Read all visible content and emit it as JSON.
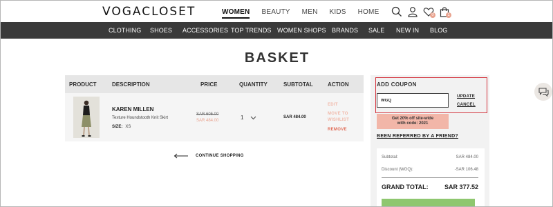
{
  "header": {
    "logo": "VOGACLOSET",
    "departments": [
      {
        "label": "WOMEN",
        "active": true
      },
      {
        "label": "BEAUTY",
        "active": false
      },
      {
        "label": "MEN",
        "active": false
      },
      {
        "label": "KIDS",
        "active": false
      },
      {
        "label": "HOME",
        "active": false
      }
    ],
    "icons": [
      "search-icon",
      "user-icon",
      "heart-icon",
      "bag-icon"
    ],
    "wishlist_count": "0",
    "bag_count": "1",
    "badge_color": "#e9a38f"
  },
  "category_nav": {
    "background": "#3a3a3a",
    "items": [
      "CLOTHING",
      "SHOES",
      "ACCESSORIES",
      "TOP TRENDS",
      "WOMEN SHOPS",
      "BRANDS",
      "SALE",
      "NEW IN",
      "BLOG"
    ]
  },
  "page": {
    "title": "BASKET"
  },
  "basket": {
    "columns": [
      "PRODUCT",
      "DESCRIPTION",
      "PRICE",
      "QUANTITY",
      "SUBTOTAL",
      "ACTION"
    ],
    "items": [
      {
        "brand": "KAREN MILLEN",
        "description": "Texture Houndstooth Knit Skirt",
        "size_label": "SIZE:",
        "size": "XS",
        "old_price": "SAR 605.00",
        "price": "SAR 484.00",
        "quantity": "1",
        "subtotal": "SAR 484.00",
        "actions": {
          "edit": "EDIT",
          "move_line1": "MOVE TO",
          "move_line2": "WISHLIST",
          "remove": "REMOVE"
        }
      }
    ],
    "continue_label": "CONTINUE SHOPPING"
  },
  "coupon": {
    "title": "ADD COUPON",
    "value": "WGQ",
    "update_label": "UPDATE",
    "cancel_label": "CANCEL",
    "highlight_color": "#d3303a",
    "promo_line1": "Get 20% off site-wide",
    "promo_line2": "with code: 2021",
    "promo_color": "#f2b6a8",
    "referred_label": "BEEN REFERRED BY A FRIEND?"
  },
  "summary": {
    "subtotal_label": "Subtotal:",
    "subtotal_value": "SAR 484.00",
    "discount_label": "Discount (WGQ):",
    "discount_value": "-SAR 106.48",
    "grand_total_label": "GRAND TOTAL:",
    "grand_total_value": "SAR 377.52",
    "checkout_color": "#8ec76f"
  },
  "chat": {
    "icon": "chat-icon"
  }
}
